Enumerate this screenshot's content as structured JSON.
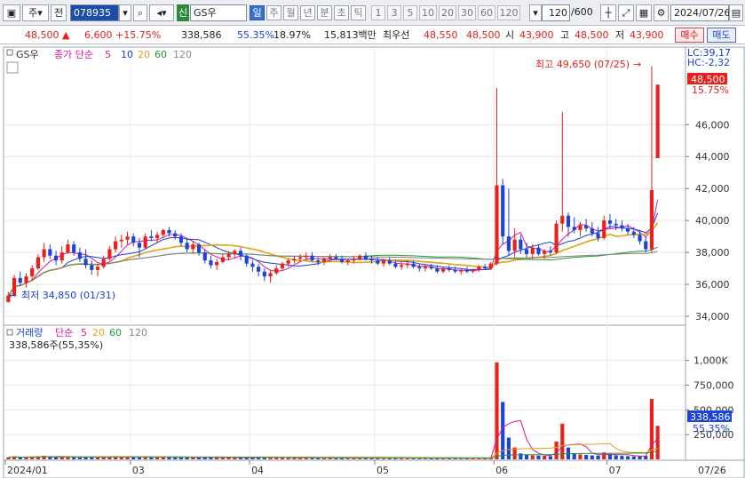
{
  "toolbar": {
    "market_label": "주",
    "scope_label": "전",
    "code_value": "078935",
    "market_badge": "신",
    "stock_name": "GS우",
    "periods": [
      "일",
      "주",
      "월",
      "년",
      "분",
      "초",
      "틱"
    ],
    "intervals": [
      "1",
      "3",
      "5",
      "10",
      "20",
      "30",
      "60",
      "120"
    ],
    "count_value": "120",
    "count_total": "/600",
    "date_value": "2024/07/26"
  },
  "quote": {
    "price": "48,500",
    "change": "6,600",
    "change_pct": "+15.75%",
    "volume": "338,586",
    "vol_ratio": "55.35%",
    "turnover": "18.97%",
    "amount": "15,813백만",
    "best_label": "최우선",
    "best_ask": "48,550",
    "best_bid": "48,500",
    "open_label": "시",
    "open": "43,900",
    "high_label": "고",
    "high": "48,500",
    "low_label": "저",
    "low": "43,900",
    "buy_label": "매수",
    "sell_label": "매도"
  },
  "price_panel": {
    "legend": {
      "stock": "GS우",
      "title": "종가 단순",
      "ma": [
        "5",
        "10",
        "20",
        "60",
        "120"
      ]
    },
    "lc_label": "LC:39,17",
    "hc_label": "HC:-2,32",
    "high_note": "최고 49,650 (07/25)",
    "low_note": "최저 34,850 (01/31)",
    "current_price": "48,500",
    "current_pct": "15.75%",
    "ticks": [
      "46,000",
      "44,000",
      "42,000",
      "40,000",
      "38,000",
      "36,000",
      "34,000"
    ]
  },
  "volume_panel": {
    "legend": {
      "title": "거래량",
      "sub": "단순",
      "ma": [
        "5",
        "20",
        "60",
        "120"
      ]
    },
    "value_label": "338,586주(55,35%)",
    "ticks": [
      "1,000K",
      "750,000",
      "500,000",
      "250,000"
    ],
    "current": "338,586",
    "current_pct": "55.35%"
  },
  "xaxis": {
    "labels": [
      "2024/01",
      "03",
      "04",
      "05",
      "06",
      "07"
    ],
    "right_label": "07/26"
  },
  "colors": {
    "up": "#e8211b",
    "down": "#1c44d6",
    "ma5": "#d4189e",
    "ma10": "#1a3fd6",
    "ma20": "#e0a415",
    "ma60": "#1e9a33",
    "ma120": "#7f7f7f"
  },
  "chart_data": {
    "type": "candlestick",
    "ylim": [
      33500,
      50800
    ],
    "volume_ylim": [
      0,
      1050000
    ],
    "candles": [
      {
        "o": 34900,
        "h": 35500,
        "l": 34850,
        "c": 35300,
        "v": 20000
      },
      {
        "o": 35300,
        "h": 36600,
        "l": 35200,
        "c": 36400,
        "v": 28000
      },
      {
        "o": 36400,
        "h": 36800,
        "l": 35900,
        "c": 36100,
        "v": 20000
      },
      {
        "o": 36100,
        "h": 36700,
        "l": 35800,
        "c": 36500,
        "v": 22000
      },
      {
        "o": 36500,
        "h": 37200,
        "l": 36200,
        "c": 37000,
        "v": 25000
      },
      {
        "o": 37000,
        "h": 37900,
        "l": 36900,
        "c": 37700,
        "v": 30000
      },
      {
        "o": 37700,
        "h": 38600,
        "l": 37400,
        "c": 38200,
        "v": 35000
      },
      {
        "o": 38200,
        "h": 38500,
        "l": 37600,
        "c": 37800,
        "v": 26000
      },
      {
        "o": 37800,
        "h": 38100,
        "l": 37200,
        "c": 37500,
        "v": 22000
      },
      {
        "o": 37500,
        "h": 38400,
        "l": 37300,
        "c": 38000,
        "v": 24000
      },
      {
        "o": 38000,
        "h": 38800,
        "l": 37900,
        "c": 38500,
        "v": 30000
      },
      {
        "o": 38500,
        "h": 38700,
        "l": 37800,
        "c": 38000,
        "v": 22000
      },
      {
        "o": 38000,
        "h": 38300,
        "l": 37400,
        "c": 37600,
        "v": 20000
      },
      {
        "o": 37600,
        "h": 38200,
        "l": 37000,
        "c": 37200,
        "v": 22000
      },
      {
        "o": 37200,
        "h": 37500,
        "l": 36600,
        "c": 36900,
        "v": 24000
      },
      {
        "o": 36900,
        "h": 37300,
        "l": 36500,
        "c": 37100,
        "v": 20000
      },
      {
        "o": 37100,
        "h": 37800,
        "l": 37000,
        "c": 37600,
        "v": 25000
      },
      {
        "o": 37600,
        "h": 38400,
        "l": 37500,
        "c": 38200,
        "v": 28000
      },
      {
        "o": 38200,
        "h": 39000,
        "l": 38000,
        "c": 38700,
        "v": 32000
      },
      {
        "o": 38700,
        "h": 39100,
        "l": 38300,
        "c": 38800,
        "v": 26000
      },
      {
        "o": 38800,
        "h": 39300,
        "l": 38500,
        "c": 39000,
        "v": 24000
      },
      {
        "o": 39000,
        "h": 39200,
        "l": 38400,
        "c": 38600,
        "v": 22000
      },
      {
        "o": 38600,
        "h": 38900,
        "l": 37700,
        "c": 38300,
        "v": 20000
      },
      {
        "o": 38300,
        "h": 39200,
        "l": 38200,
        "c": 39000,
        "v": 30000
      },
      {
        "o": 39000,
        "h": 39400,
        "l": 38700,
        "c": 38900,
        "v": 22000
      },
      {
        "o": 38900,
        "h": 39300,
        "l": 38600,
        "c": 39100,
        "v": 20000
      },
      {
        "o": 39100,
        "h": 39500,
        "l": 38900,
        "c": 39400,
        "v": 24000
      },
      {
        "o": 39400,
        "h": 39600,
        "l": 39000,
        "c": 39200,
        "v": 20000
      },
      {
        "o": 39200,
        "h": 39400,
        "l": 38800,
        "c": 39000,
        "v": 18000
      },
      {
        "o": 39000,
        "h": 39200,
        "l": 38400,
        "c": 38600,
        "v": 18000
      },
      {
        "o": 38600,
        "h": 38900,
        "l": 38000,
        "c": 38200,
        "v": 20000
      },
      {
        "o": 38200,
        "h": 38700,
        "l": 37900,
        "c": 38500,
        "v": 18000
      },
      {
        "o": 38500,
        "h": 38600,
        "l": 37800,
        "c": 38000,
        "v": 18000
      },
      {
        "o": 38000,
        "h": 38200,
        "l": 37300,
        "c": 37500,
        "v": 20000
      },
      {
        "o": 37500,
        "h": 37800,
        "l": 37000,
        "c": 37200,
        "v": 20000
      },
      {
        "o": 37200,
        "h": 37600,
        "l": 36900,
        "c": 37400,
        "v": 18000
      },
      {
        "o": 37400,
        "h": 37900,
        "l": 37300,
        "c": 37700,
        "v": 16000
      },
      {
        "o": 37700,
        "h": 38100,
        "l": 37500,
        "c": 37900,
        "v": 18000
      },
      {
        "o": 37900,
        "h": 38200,
        "l": 37600,
        "c": 38100,
        "v": 16000
      },
      {
        "o": 38100,
        "h": 38300,
        "l": 37500,
        "c": 37800,
        "v": 16000
      },
      {
        "o": 37800,
        "h": 37900,
        "l": 37100,
        "c": 37300,
        "v": 18000
      },
      {
        "o": 37300,
        "h": 37500,
        "l": 36800,
        "c": 37100,
        "v": 18000
      },
      {
        "o": 37100,
        "h": 37300,
        "l": 36500,
        "c": 36800,
        "v": 20000
      },
      {
        "o": 36800,
        "h": 37000,
        "l": 36200,
        "c": 36500,
        "v": 22000
      },
      {
        "o": 36500,
        "h": 36900,
        "l": 36100,
        "c": 36700,
        "v": 18000
      },
      {
        "o": 36700,
        "h": 37200,
        "l": 36600,
        "c": 37000,
        "v": 16000
      },
      {
        "o": 37000,
        "h": 37400,
        "l": 36900,
        "c": 37300,
        "v": 16000
      },
      {
        "o": 37300,
        "h": 37600,
        "l": 37100,
        "c": 37500,
        "v": 15000
      },
      {
        "o": 37500,
        "h": 37800,
        "l": 37300,
        "c": 37600,
        "v": 15000
      },
      {
        "o": 37600,
        "h": 37900,
        "l": 37400,
        "c": 37700,
        "v": 14000
      },
      {
        "o": 37700,
        "h": 38000,
        "l": 37500,
        "c": 37800,
        "v": 14000
      },
      {
        "o": 37800,
        "h": 38000,
        "l": 37400,
        "c": 37500,
        "v": 14000
      },
      {
        "o": 37500,
        "h": 37700,
        "l": 37200,
        "c": 37400,
        "v": 13000
      },
      {
        "o": 37400,
        "h": 37700,
        "l": 37200,
        "c": 37600,
        "v": 13000
      },
      {
        "o": 37600,
        "h": 37900,
        "l": 37400,
        "c": 37700,
        "v": 14000
      },
      {
        "o": 37700,
        "h": 37900,
        "l": 37500,
        "c": 37600,
        "v": 13000
      },
      {
        "o": 37600,
        "h": 37800,
        "l": 37300,
        "c": 37400,
        "v": 13000
      },
      {
        "o": 37400,
        "h": 37600,
        "l": 37200,
        "c": 37500,
        "v": 12000
      },
      {
        "o": 37500,
        "h": 37800,
        "l": 37300,
        "c": 37600,
        "v": 12000
      },
      {
        "o": 37600,
        "h": 37900,
        "l": 37500,
        "c": 37800,
        "v": 13000
      },
      {
        "o": 37800,
        "h": 38000,
        "l": 37500,
        "c": 37600,
        "v": 13000
      },
      {
        "o": 37600,
        "h": 37800,
        "l": 37300,
        "c": 37500,
        "v": 12000
      },
      {
        "o": 37500,
        "h": 37700,
        "l": 37200,
        "c": 37300,
        "v": 12000
      },
      {
        "o": 37300,
        "h": 37600,
        "l": 37100,
        "c": 37500,
        "v": 12000
      },
      {
        "o": 37500,
        "h": 37700,
        "l": 37200,
        "c": 37300,
        "v": 12000
      },
      {
        "o": 37300,
        "h": 37500,
        "l": 37000,
        "c": 37100,
        "v": 13000
      },
      {
        "o": 37100,
        "h": 37400,
        "l": 36900,
        "c": 37200,
        "v": 12000
      },
      {
        "o": 37200,
        "h": 37500,
        "l": 37000,
        "c": 37300,
        "v": 12000
      },
      {
        "o": 37300,
        "h": 37500,
        "l": 37000,
        "c": 37100,
        "v": 12000
      },
      {
        "o": 37100,
        "h": 37300,
        "l": 36800,
        "c": 37000,
        "v": 12000
      },
      {
        "o": 37000,
        "h": 37200,
        "l": 36800,
        "c": 37100,
        "v": 11000
      },
      {
        "o": 37100,
        "h": 37300,
        "l": 36900,
        "c": 37000,
        "v": 11000
      },
      {
        "o": 37000,
        "h": 37200,
        "l": 36700,
        "c": 36800,
        "v": 12000
      },
      {
        "o": 36800,
        "h": 37100,
        "l": 36700,
        "c": 37000,
        "v": 11000
      },
      {
        "o": 37000,
        "h": 37200,
        "l": 36800,
        "c": 36900,
        "v": 11000
      },
      {
        "o": 36900,
        "h": 37100,
        "l": 36700,
        "c": 36800,
        "v": 11000
      },
      {
        "o": 36800,
        "h": 37000,
        "l": 36600,
        "c": 36900,
        "v": 11000
      },
      {
        "o": 36900,
        "h": 37100,
        "l": 36700,
        "c": 36800,
        "v": 11000
      },
      {
        "o": 36800,
        "h": 37000,
        "l": 36700,
        "c": 36900,
        "v": 11000
      },
      {
        "o": 36900,
        "h": 37200,
        "l": 36800,
        "c": 37100,
        "v": 12000
      },
      {
        "o": 37100,
        "h": 37300,
        "l": 36900,
        "c": 37000,
        "v": 12000
      },
      {
        "o": 37000,
        "h": 37400,
        "l": 36900,
        "c": 37300,
        "v": 13000
      },
      {
        "o": 37300,
        "h": 48300,
        "l": 37200,
        "c": 42200,
        "v": 980000
      },
      {
        "o": 42200,
        "h": 42600,
        "l": 38500,
        "c": 39000,
        "v": 580000
      },
      {
        "o": 39000,
        "h": 42000,
        "l": 37800,
        "c": 38100,
        "v": 220000
      },
      {
        "o": 38100,
        "h": 39500,
        "l": 37700,
        "c": 38800,
        "v": 120000
      },
      {
        "o": 38800,
        "h": 39100,
        "l": 37900,
        "c": 38200,
        "v": 60000
      },
      {
        "o": 38200,
        "h": 38600,
        "l": 37700,
        "c": 37900,
        "v": 45000
      },
      {
        "o": 37900,
        "h": 38500,
        "l": 37600,
        "c": 38300,
        "v": 40000
      },
      {
        "o": 38300,
        "h": 38500,
        "l": 37800,
        "c": 37900,
        "v": 38000
      },
      {
        "o": 37900,
        "h": 38200,
        "l": 37600,
        "c": 38100,
        "v": 36000
      },
      {
        "o": 38100,
        "h": 38400,
        "l": 37800,
        "c": 38000,
        "v": 32000
      },
      {
        "o": 38000,
        "h": 40000,
        "l": 37900,
        "c": 39800,
        "v": 180000
      },
      {
        "o": 39800,
        "h": 46800,
        "l": 39300,
        "c": 40300,
        "v": 360000
      },
      {
        "o": 40300,
        "h": 40500,
        "l": 39000,
        "c": 39600,
        "v": 120000
      },
      {
        "o": 39600,
        "h": 40200,
        "l": 39200,
        "c": 39400,
        "v": 60000
      },
      {
        "o": 39400,
        "h": 39900,
        "l": 39000,
        "c": 39700,
        "v": 50000
      },
      {
        "o": 39700,
        "h": 40100,
        "l": 39300,
        "c": 39500,
        "v": 45000
      },
      {
        "o": 39500,
        "h": 39900,
        "l": 39000,
        "c": 39200,
        "v": 40000
      },
      {
        "o": 39200,
        "h": 39600,
        "l": 38700,
        "c": 38900,
        "v": 38000
      },
      {
        "o": 38900,
        "h": 40300,
        "l": 38800,
        "c": 40000,
        "v": 70000
      },
      {
        "o": 40000,
        "h": 40400,
        "l": 39500,
        "c": 39800,
        "v": 55000
      },
      {
        "o": 39800,
        "h": 40100,
        "l": 39400,
        "c": 39700,
        "v": 40000
      },
      {
        "o": 39700,
        "h": 40000,
        "l": 39300,
        "c": 39500,
        "v": 35000
      },
      {
        "o": 39500,
        "h": 39800,
        "l": 39100,
        "c": 39300,
        "v": 32000
      },
      {
        "o": 39300,
        "h": 39600,
        "l": 38900,
        "c": 39100,
        "v": 30000
      },
      {
        "o": 39100,
        "h": 39400,
        "l": 38500,
        "c": 38700,
        "v": 30000
      },
      {
        "o": 38700,
        "h": 39000,
        "l": 38000,
        "c": 38200,
        "v": 35000
      },
      {
        "o": 38200,
        "h": 49650,
        "l": 38000,
        "c": 41900,
        "v": 610000
      },
      {
        "o": 43900,
        "h": 48500,
        "l": 43900,
        "c": 48500,
        "v": 338586
      }
    ]
  }
}
